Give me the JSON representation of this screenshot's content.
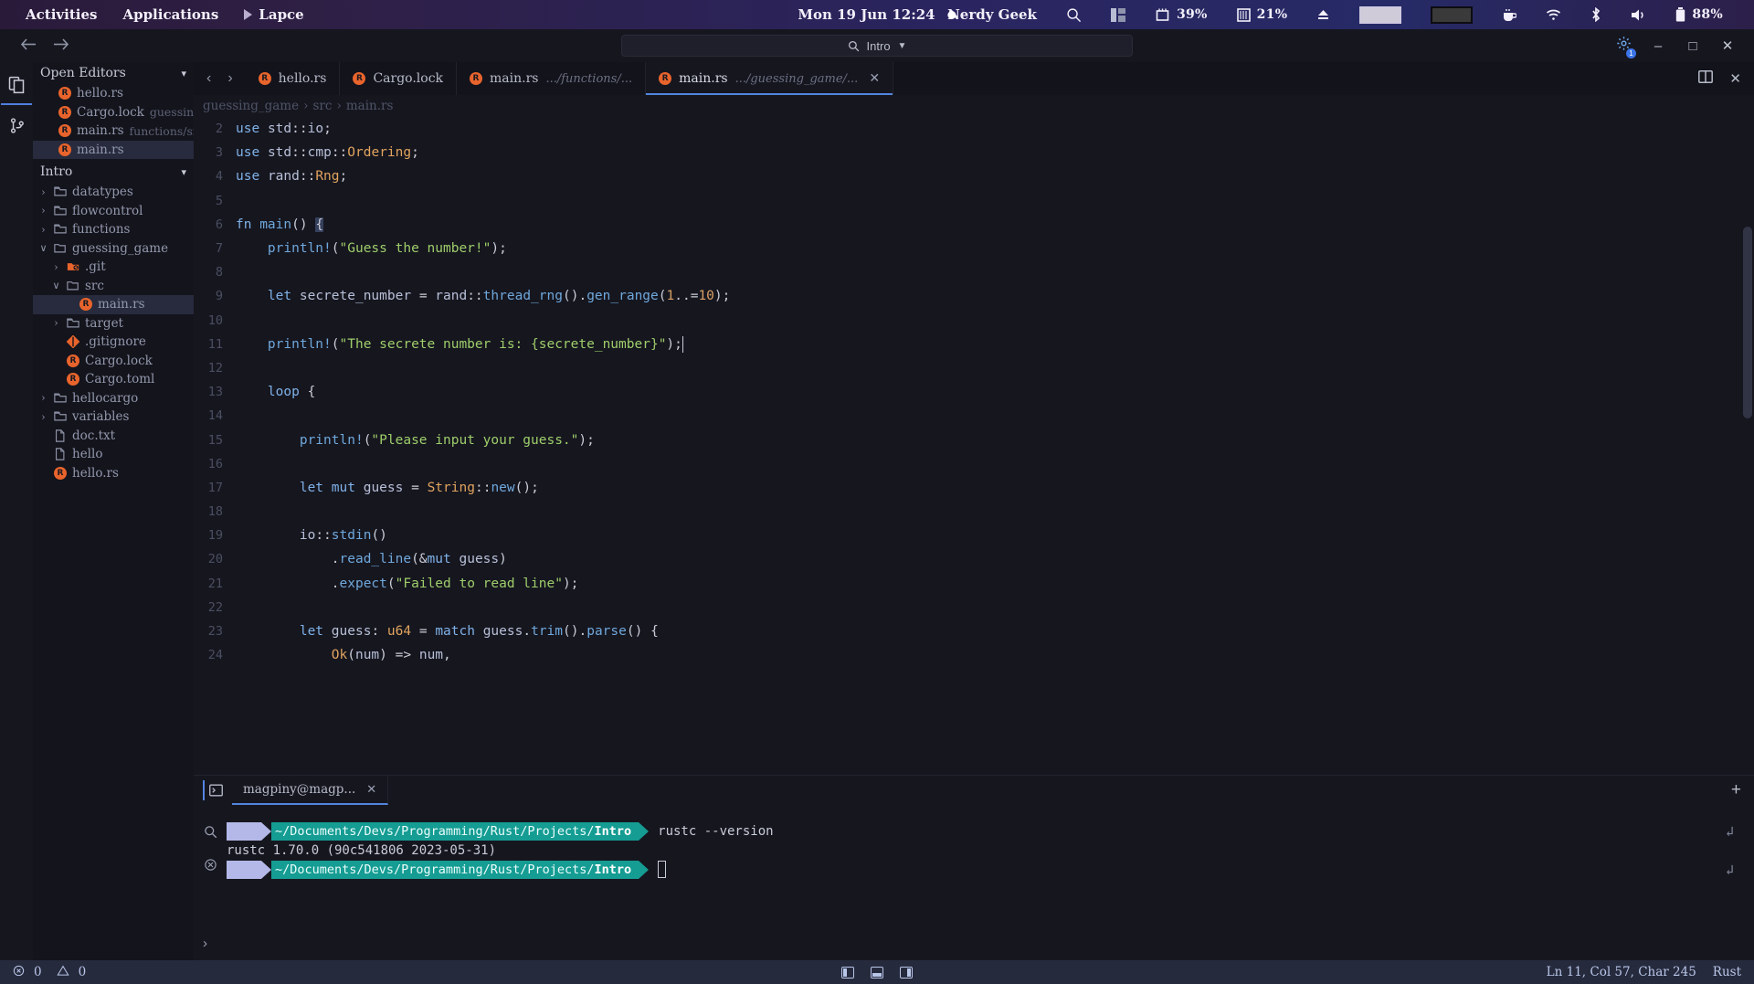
{
  "topbar": {
    "activities": "Activities",
    "applications": "Applications",
    "app_name": "Lapce",
    "app_icon": "play-triangle-icon",
    "clock": "Mon 19 Jun  12:24",
    "recording_dot": "record-dot-icon",
    "user": "Nerdy Geek",
    "search_icon": "search-icon",
    "layout_icon": "layout-icon",
    "cpu_icon": "cpu-icon",
    "cpu": "39%",
    "ram_icon": "ram-icon",
    "ram": "21%",
    "eject_icon": "eject-icon",
    "coffee_icon": "coffee-icon",
    "wifi_icon": "wifi-icon",
    "bluetooth_icon": "bluetooth-icon",
    "volume_icon": "volume-icon",
    "battery_icon": "battery-icon",
    "battery": "88%"
  },
  "titlebar": {
    "back_icon": "arrow-left-icon",
    "forward_icon": "arrow-right-icon",
    "search_icon": "search-icon",
    "search_value": "Intro",
    "search_chevron": "chevron-down-icon",
    "gear_icon": "gear-icon",
    "gear_badge": "1",
    "minimize": "–",
    "maximize": "□",
    "close": "✕"
  },
  "activitybar": {
    "items": [
      {
        "name": "explorer-icon",
        "label": "Explorer",
        "active": true
      },
      {
        "name": "source-control-icon",
        "label": "Source Control",
        "active": false
      }
    ]
  },
  "sidebar": {
    "open_editors": {
      "title": "Open Editors",
      "chevron": "chevron-down-icon",
      "items": [
        {
          "label": "hello.rs",
          "sub": "",
          "icon": "rust-icon",
          "selected": false
        },
        {
          "label": "Cargo.lock",
          "sub": "guessing_ga",
          "icon": "rust-icon",
          "selected": false
        },
        {
          "label": "main.rs",
          "sub": "functions/src",
          "icon": "rust-icon",
          "selected": false
        },
        {
          "label": "main.rs",
          "sub": "",
          "icon": "rust-icon",
          "selected": true
        }
      ]
    },
    "workspace": {
      "title": "Intro",
      "chevron": "chevron-down-icon",
      "items": [
        {
          "label": "datatypes",
          "indent": 1,
          "arrow": "›",
          "icon": "folder-icon",
          "selected": false
        },
        {
          "label": "flowcontrol",
          "indent": 1,
          "arrow": "›",
          "icon": "folder-icon",
          "selected": false
        },
        {
          "label": "functions",
          "indent": 1,
          "arrow": "›",
          "icon": "folder-icon",
          "selected": false
        },
        {
          "label": "guessing_game",
          "indent": 1,
          "arrow": "∨",
          "icon": "folder-open-icon",
          "selected": false
        },
        {
          "label": ".git",
          "indent": 2,
          "arrow": "›",
          "icon": "git-folder-icon",
          "selected": false
        },
        {
          "label": "src",
          "indent": 2,
          "arrow": "∨",
          "icon": "folder-open-icon",
          "selected": false
        },
        {
          "label": "main.rs",
          "indent": 3,
          "arrow": "",
          "icon": "rust-icon",
          "selected": true
        },
        {
          "label": "target",
          "indent": 2,
          "arrow": "›",
          "icon": "folder-icon",
          "selected": false
        },
        {
          "label": ".gitignore",
          "indent": 2,
          "arrow": "",
          "icon": "git-icon",
          "selected": false
        },
        {
          "label": "Cargo.lock",
          "indent": 2,
          "arrow": "",
          "icon": "rust-icon",
          "selected": false
        },
        {
          "label": "Cargo.toml",
          "indent": 2,
          "arrow": "",
          "icon": "rust-icon",
          "selected": false
        },
        {
          "label": "hellocargo",
          "indent": 1,
          "arrow": "›",
          "icon": "folder-icon",
          "selected": false
        },
        {
          "label": "variables",
          "indent": 1,
          "arrow": "›",
          "icon": "folder-icon",
          "selected": false
        },
        {
          "label": "doc.txt",
          "indent": 1,
          "arrow": "",
          "icon": "file-icon",
          "selected": false
        },
        {
          "label": "hello",
          "indent": 1,
          "arrow": "",
          "icon": "file-icon",
          "selected": false
        },
        {
          "label": "hello.rs",
          "indent": 1,
          "arrow": "",
          "icon": "rust-icon",
          "selected": false
        }
      ]
    }
  },
  "editor": {
    "tabs": [
      {
        "label": "hello.rs",
        "path": "",
        "icon": "rust-icon",
        "active": false,
        "closable": false
      },
      {
        "label": "Cargo.lock",
        "path": "",
        "icon": "rust-icon",
        "active": false,
        "closable": false
      },
      {
        "label": "main.rs",
        "path": ".../functions/...",
        "icon": "rust-icon",
        "active": false,
        "closable": false
      },
      {
        "label": "main.rs",
        "path": ".../guessing_game/...",
        "icon": "rust-icon",
        "active": true,
        "closable": true
      }
    ],
    "tab_close_icon": "close-icon",
    "split_icon": "split-editor-icon",
    "close_icon": "close-icon",
    "breadcrumb": [
      "guessing_game",
      "src",
      "main.rs"
    ],
    "breadcrumb_separator": "›"
  },
  "code": {
    "first_visible_line": 2,
    "lines": [
      {
        "n": 2,
        "text": "use std::io;"
      },
      {
        "n": 3,
        "text": "use std::cmp::Ordering;"
      },
      {
        "n": 4,
        "text": "use rand::Rng;"
      },
      {
        "n": 5,
        "text": ""
      },
      {
        "n": 6,
        "text": "fn main() {"
      },
      {
        "n": 7,
        "text": "    println!(\"Guess the number!\");"
      },
      {
        "n": 8,
        "text": ""
      },
      {
        "n": 9,
        "text": "    let secrete_number = rand::thread_rng().gen_range(1..=10);"
      },
      {
        "n": 10,
        "text": ""
      },
      {
        "n": 11,
        "text": "    println!(\"The secrete number is: {secrete_number}\");"
      },
      {
        "n": 12,
        "text": ""
      },
      {
        "n": 13,
        "text": "    loop {"
      },
      {
        "n": 14,
        "text": ""
      },
      {
        "n": 15,
        "text": "        println!(\"Please input your guess.\");"
      },
      {
        "n": 16,
        "text": ""
      },
      {
        "n": 17,
        "text": "        let mut guess = String::new();"
      },
      {
        "n": 18,
        "text": ""
      },
      {
        "n": 19,
        "text": "        io::stdin()"
      },
      {
        "n": 20,
        "text": "            .read_line(&mut guess)"
      },
      {
        "n": 21,
        "text": "            .expect(\"Failed to read line\");"
      },
      {
        "n": 22,
        "text": ""
      },
      {
        "n": 23,
        "text": "        let guess: u64 = match guess.trim().parse() {"
      },
      {
        "n": 24,
        "text": "            Ok(num) => num,"
      }
    ]
  },
  "panel": {
    "terminal_icon": "terminal-icon",
    "tab_label": "magpiny@magp...",
    "tab_close_icon": "close-icon",
    "add_icon": "plus-icon",
    "search_icon": "search-icon",
    "clear_icon": "clear-icon",
    "expand_icon": "chevron-right-icon",
    "scroll_icon": "scroll-to-icon",
    "prompt_path": "~/Documents/Devs/Programming/Rust/Projects/",
    "prompt_dir": "Intro",
    "lines": [
      {
        "type": "prompt",
        "command": "rustc --version"
      },
      {
        "type": "output",
        "text": "rustc 1.70.0 (90c541806 2023-05-31)"
      },
      {
        "type": "prompt",
        "command": ""
      }
    ]
  },
  "statusbar": {
    "error_icon": "error-icon",
    "errors": "0",
    "warning_icon": "warning-icon",
    "warnings": "0",
    "panel_left_icon": "panel-left-icon",
    "panel_bottom_icon": "panel-bottom-icon",
    "panel_right_icon": "panel-right-icon",
    "position": "Ln 11, Col 57, Char 245",
    "language": "Rust"
  }
}
